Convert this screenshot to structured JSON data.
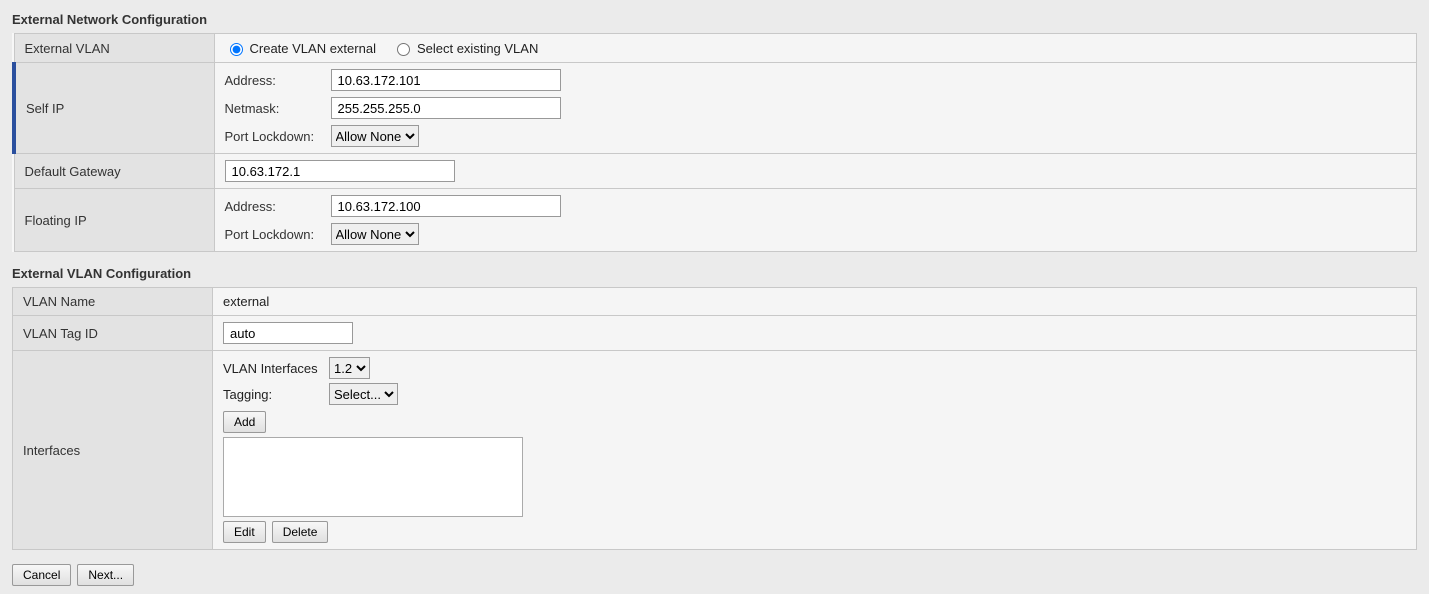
{
  "sections": {
    "extNet": {
      "title": "External Network Configuration",
      "rows": {
        "extVlan": {
          "label": "External VLAN",
          "createLabel": "Create VLAN external",
          "selectLabel": "Select existing VLAN"
        },
        "selfIp": {
          "label": "Self IP",
          "addressLabel": "Address:",
          "addressValue": "10.63.172.101",
          "netmaskLabel": "Netmask:",
          "netmaskValue": "255.255.255.0",
          "portLockdownLabel": "Port Lockdown:",
          "portLockdownValue": "Allow None"
        },
        "gateway": {
          "label": "Default Gateway",
          "value": "10.63.172.1"
        },
        "floatingIp": {
          "label": "Floating IP",
          "addressLabel": "Address:",
          "addressValue": "10.63.172.100",
          "portLockdownLabel": "Port Lockdown:",
          "portLockdownValue": "Allow None"
        }
      }
    },
    "extVlanCfg": {
      "title": "External VLAN Configuration",
      "rows": {
        "vlanName": {
          "label": "VLAN Name",
          "value": "external"
        },
        "vlanTagId": {
          "label": "VLAN Tag ID",
          "value": "auto"
        },
        "interfaces": {
          "label": "Interfaces",
          "vlanInterfacesLabel": "VLAN Interfaces",
          "vlanInterfacesValue": "1.2",
          "taggingLabel": "Tagging:",
          "taggingValue": "Select...",
          "addLabel": "Add",
          "editLabel": "Edit",
          "deleteLabel": "Delete"
        }
      }
    }
  },
  "footer": {
    "cancel": "Cancel",
    "next": "Next..."
  }
}
